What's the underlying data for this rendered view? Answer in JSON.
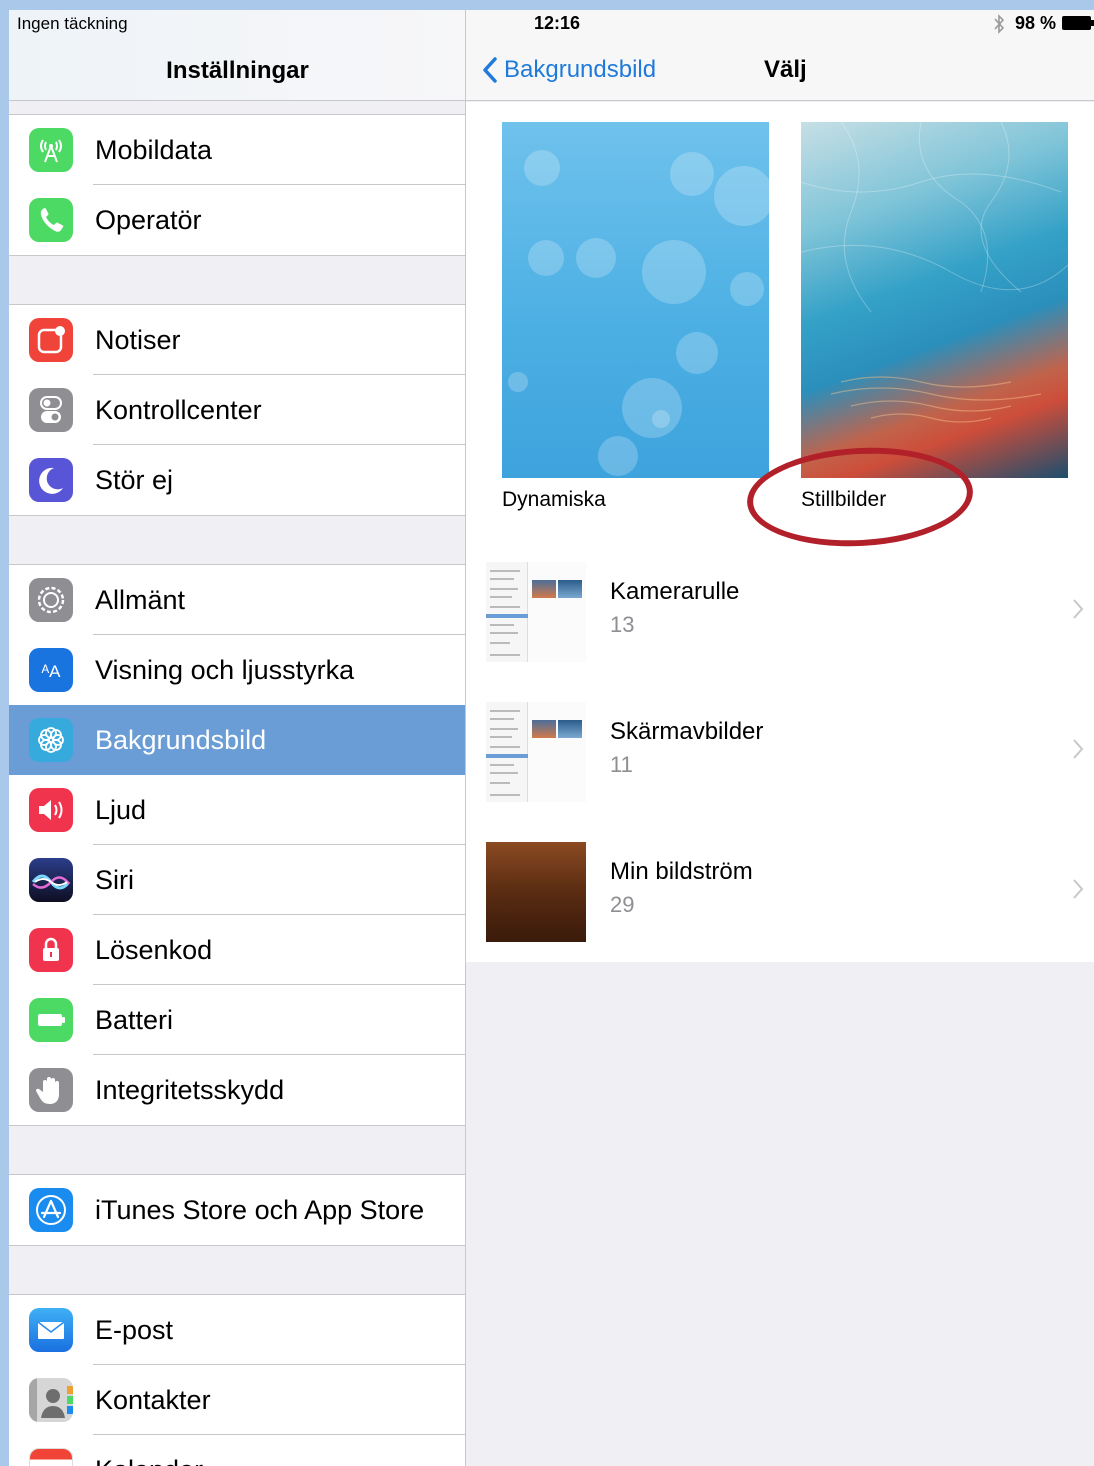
{
  "status_bar": {
    "carrier": "Ingen täckning",
    "time": "12:16",
    "battery": "98 %"
  },
  "sidebar": {
    "title": "Inställningar",
    "groups": [
      {
        "items": [
          {
            "label": "Mobildata",
            "icon": "cellular-icon",
            "color": "#4cd964"
          },
          {
            "label": "Operatör",
            "icon": "phone-icon",
            "color": "#4cd964"
          }
        ]
      },
      {
        "items": [
          {
            "label": "Notiser",
            "icon": "notifications-icon",
            "color": "#f0443a"
          },
          {
            "label": "Kontrollcenter",
            "icon": "control-center-icon",
            "color": "#8e8e93"
          },
          {
            "label": "Stör ej",
            "icon": "moon-icon",
            "color": "#5856d6"
          }
        ]
      },
      {
        "items": [
          {
            "label": "Allmänt",
            "icon": "gear-icon",
            "color": "#8e8e93"
          },
          {
            "label": "Visning och ljusstyrka",
            "icon": "display-icon",
            "color": "#1a74e0"
          },
          {
            "label": "Bakgrundsbild",
            "icon": "wallpaper-icon",
            "color": "#36aadc",
            "selected": true
          },
          {
            "label": "Ljud",
            "icon": "speaker-icon",
            "color": "#f1344e"
          },
          {
            "label": "Siri",
            "icon": "siri-icon",
            "color": "#1d1d3a"
          },
          {
            "label": "Lösenkod",
            "icon": "lock-icon",
            "color": "#f1344e"
          },
          {
            "label": "Batteri",
            "icon": "battery-icon",
            "color": "#4cd964"
          },
          {
            "label": "Integritetsskydd",
            "icon": "hand-icon",
            "color": "#8e8e93"
          }
        ]
      },
      {
        "items": [
          {
            "label": "iTunes Store och App Store",
            "icon": "app-store-icon",
            "color": "#1a8cf0"
          }
        ]
      },
      {
        "items": [
          {
            "label": "E-post",
            "icon": "mail-icon",
            "color": "#1a8cf0"
          },
          {
            "label": "Kontakter",
            "icon": "contacts-icon",
            "color": "#8e8e93"
          },
          {
            "label": "Kalender",
            "icon": "calendar-icon",
            "color": "#f14336"
          }
        ]
      }
    ]
  },
  "detail": {
    "back_label": "Bakgrundsbild",
    "title": "Välj",
    "thumbnails": [
      {
        "label": "Dynamiska"
      },
      {
        "label": "Stillbilder"
      }
    ],
    "albums": [
      {
        "title": "Kamerarulle",
        "count": "13"
      },
      {
        "title": "Skärmavbilder",
        "count": "11"
      },
      {
        "title": "Min bildström",
        "count": "29"
      }
    ]
  },
  "colors": {
    "accent": "#1f7ad9",
    "selected_row": "#6a9cd5",
    "highlight_ring": "#b2202a"
  }
}
